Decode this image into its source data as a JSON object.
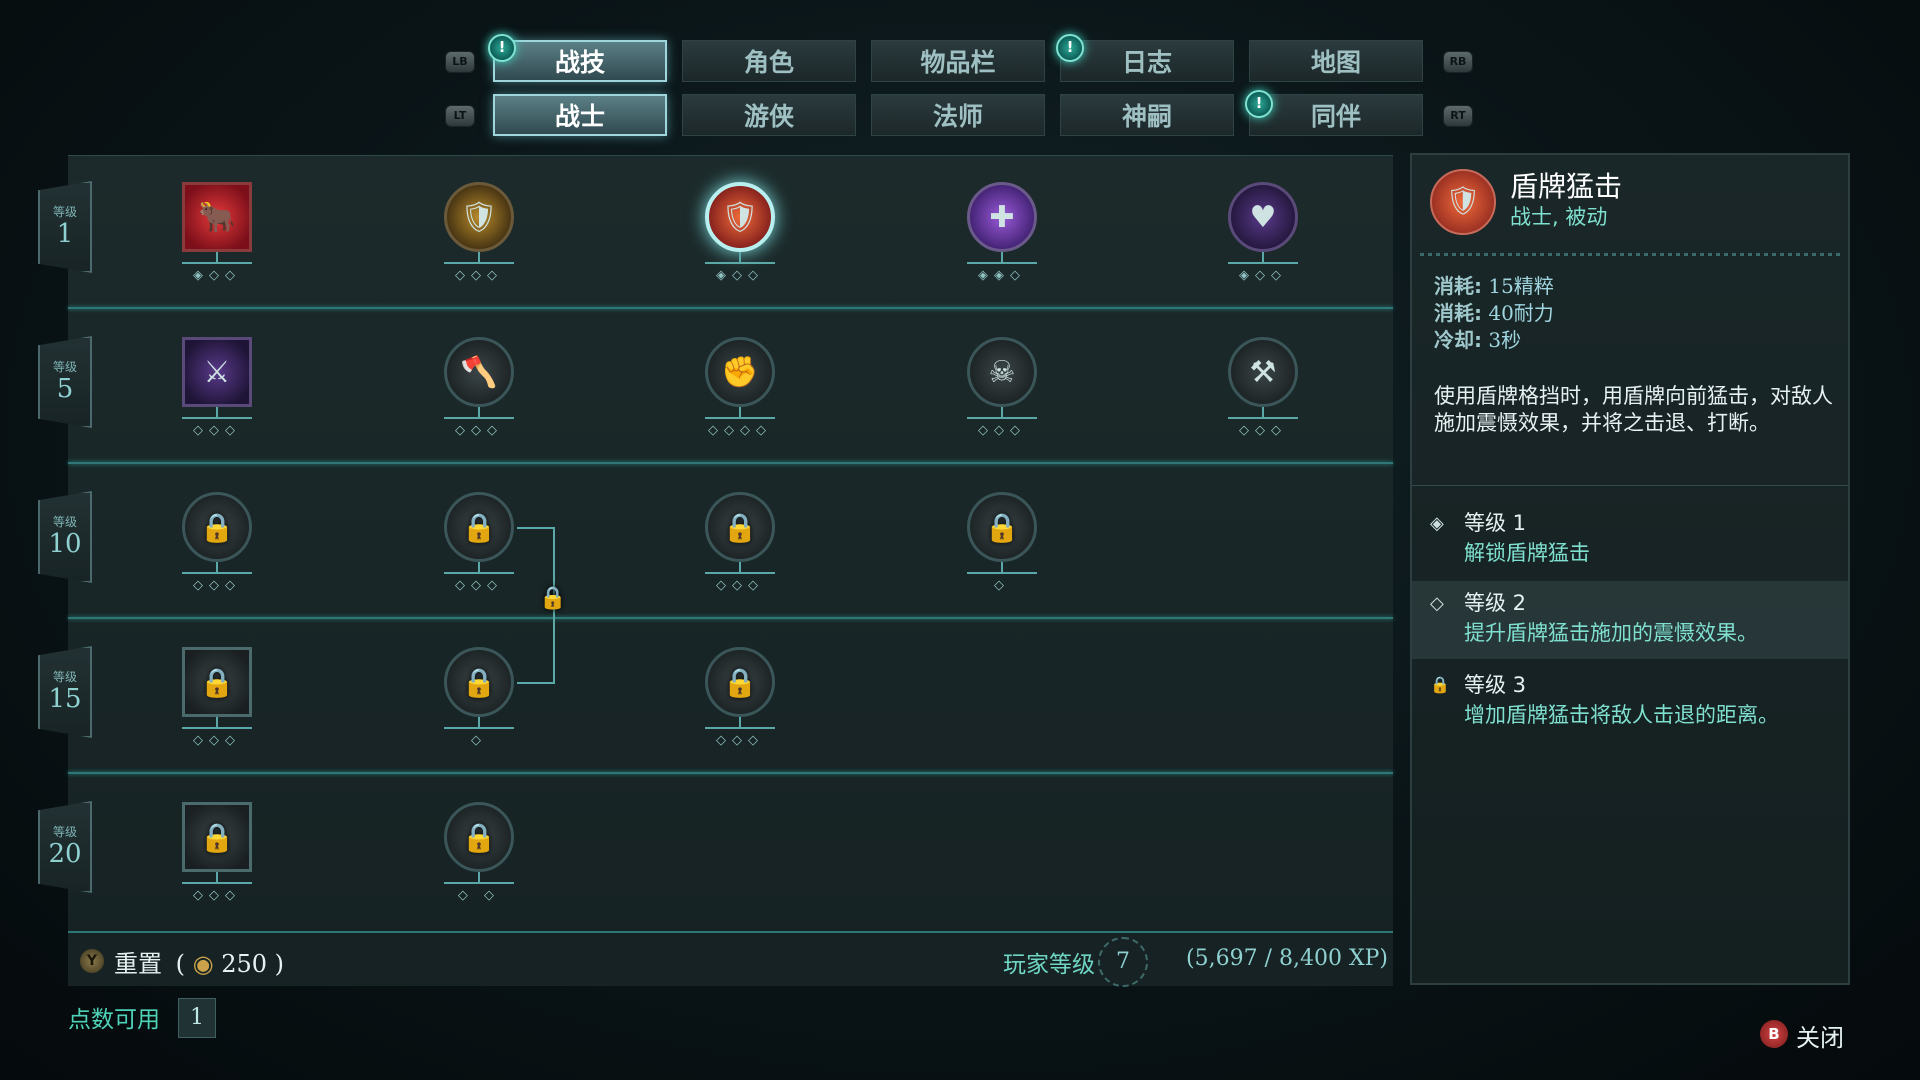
{
  "nav": {
    "lb": "LB",
    "rb": "RB",
    "lt": "LT",
    "rt": "RT",
    "top_tabs": [
      "战技",
      "角色",
      "物品栏",
      "日志",
      "地图"
    ],
    "sub_tabs": [
      "战士",
      "游侠",
      "法师",
      "神嗣",
      "同伴"
    ]
  },
  "tree": {
    "level_label": "等级",
    "levels": [
      "1",
      "5",
      "10",
      "15",
      "20"
    ]
  },
  "footer": {
    "y_button": "Y",
    "reset_label": "重置",
    "reset_cost": "250",
    "player_level_label": "玩家等级",
    "player_level": "7",
    "xp": "(5,697 / 8,400 XP)",
    "points_label": "点数可用",
    "points_value": "1",
    "b_button": "B",
    "close_label": "关闭"
  },
  "detail": {
    "title": "盾牌猛击",
    "subtitle": "战士, 被动",
    "stats": [
      {
        "key": "消耗:",
        "value": "15精粹"
      },
      {
        "key": "消耗:",
        "value": "40耐力"
      },
      {
        "key": "冷却:",
        "value": "3秒"
      }
    ],
    "description": "使用盾牌格挡时，用盾牌向前猛击，对敌人施加震慑效果，并将之击退、打断。",
    "ranks": [
      {
        "icon": "◈",
        "label": "等级 1",
        "text": "解锁盾牌猛击"
      },
      {
        "icon": "◇",
        "label": "等级 2",
        "text": "提升盾牌猛击施加的震慑效果。"
      },
      {
        "icon": "🔒",
        "label": "等级 3",
        "text": "增加盾牌猛击将敌人击退的距离。"
      }
    ]
  },
  "colors": {
    "accent": "#7fe0d0",
    "lock": "#e0902a",
    "row_line": "#2f7777"
  }
}
